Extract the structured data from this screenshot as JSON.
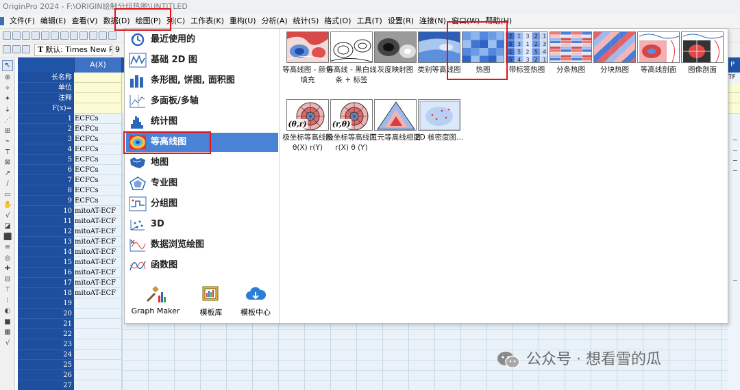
{
  "window": {
    "title": "OriginPro 2024 - F:\\ORIGIN绘制分组热图\\UNTITLED"
  },
  "menubar": [
    "文件(F)",
    "编辑(E)",
    "查看(V)",
    "数据(D)",
    "绘图(P)",
    "列(C)",
    "工作表(K)",
    "重构(U)",
    "分析(A)",
    "统计(S)",
    "格式(O)",
    "工具(T)",
    "设置(R)",
    "连接(N)",
    "窗口(W)",
    "帮助(H)"
  ],
  "toolbar": {
    "font_name": "默认: Times New R",
    "font_size": "9"
  },
  "sheet": {
    "column_a_header": "A(X)",
    "row_labels": [
      "长名称",
      "单位",
      "注释",
      "F(x)="
    ],
    "row_numbers": [
      "1",
      "2",
      "3",
      "4",
      "5",
      "6",
      "7",
      "8",
      "9",
      "10",
      "11",
      "12",
      "13",
      "14",
      "15",
      "16",
      "17",
      "18",
      "19",
      "20",
      "21",
      "22",
      "23",
      "24",
      "25",
      "26",
      "27"
    ],
    "column_a_values": [
      "ECFCs",
      "ECFCs",
      "ECFCs",
      "ECFCs",
      "ECFCs",
      "ECFCs",
      "ECFCs",
      "ECFCs",
      "ECFCs",
      "mitoAT-ECF",
      "mitoAT-ECF",
      "mitoAT-ECF",
      "mitoAT-ECF",
      "mitoAT-ECF",
      "mitoAT-ECF",
      "mitoAT-ECF",
      "mitoAT-ECF",
      "mitoAT-ECF"
    ],
    "right_column_header": "P",
    "right_column_top_cell": "TF"
  },
  "plot_menu": {
    "categories": [
      {
        "label": "最近使用的",
        "icon": "recent-clock-icon",
        "selected": false
      },
      {
        "label": "基础 2D 图",
        "icon": "basic-2d-line-icon",
        "selected": false
      },
      {
        "label": "条形图, 饼图, 面积图",
        "icon": "bar-chart-icon",
        "selected": false
      },
      {
        "label": "多面板/多轴",
        "icon": "multi-panel-icon",
        "selected": false
      },
      {
        "label": "统计图",
        "icon": "histogram-icon",
        "selected": false
      },
      {
        "label": "等高线图",
        "icon": "contour-icon",
        "selected": true
      },
      {
        "label": "地图",
        "icon": "map-icon",
        "selected": false
      },
      {
        "label": "专业图",
        "icon": "specialized-polar-icon",
        "selected": false
      },
      {
        "label": "分组图",
        "icon": "grouped-plot-icon",
        "selected": false
      },
      {
        "label": "3D",
        "icon": "3d-scatter-icon",
        "selected": false
      },
      {
        "label": "数据浏览绘图",
        "icon": "data-explore-icon",
        "selected": false
      },
      {
        "label": "函数图",
        "icon": "function-plot-icon",
        "selected": false
      }
    ],
    "bottom_buttons": [
      {
        "label": "Graph Maker",
        "icon": "graph-maker-icon"
      },
      {
        "label": "模板库",
        "icon": "template-library-icon"
      },
      {
        "label": "模板中心",
        "icon": "template-center-cloud-icon"
      }
    ],
    "gallery": [
      {
        "label": "等高线图 - 颜色填充",
        "icon": "contour-color-fill-thumb"
      },
      {
        "label": "等高线 - 黑白线条 + 标签",
        "icon": "contour-bw-lines-thumb"
      },
      {
        "label": "灰度映射图",
        "icon": "gray-scale-map-thumb"
      },
      {
        "label": "类别等高线图",
        "icon": "category-contour-thumb"
      },
      {
        "label": "热图",
        "icon": "heatmap-thumb"
      },
      {
        "label": "带标签热图",
        "icon": "labeled-heatmap-thumb"
      },
      {
        "label": "分条热图",
        "icon": "split-stripe-heatmap-thumb"
      },
      {
        "label": "分块热图",
        "icon": "split-block-heatmap-thumb"
      },
      {
        "label": "等高线剖面",
        "icon": "contour-profile-thumb"
      },
      {
        "label": "图像剖面",
        "icon": "image-profile-thumb"
      },
      {
        "label": "极坐标等高线图θ(X) r(Y)",
        "icon": "polar-contour-theta-r-thumb",
        "glyph": "(θ,r)"
      },
      {
        "label": "极坐标等高线图 r(X) θ (Y)",
        "icon": "polar-contour-r-theta-thumb",
        "glyph": "(r,θ)"
      },
      {
        "label": "三元等高线相图",
        "icon": "ternary-contour-thumb"
      },
      {
        "label": "2D 核密度图...",
        "icon": "2d-kernel-density-thumb"
      }
    ],
    "labeled_heatmap_numbers": [
      "2",
      "1",
      "3",
      "2",
      "1",
      "5",
      "3",
      "1",
      "2",
      "3",
      "1",
      "5",
      "2",
      "5",
      "4",
      "5",
      "4",
      "3",
      "2",
      "1"
    ]
  },
  "watermark": {
    "text": "公众号 · 想看雪的瓜",
    "icon": "wechat-icon"
  },
  "colors": {
    "accent_selected": "#4a83d5",
    "highlight_red": "#e0121b",
    "sheet_header_blue": "#1f54a6",
    "cell_blue": "#eaf3fa",
    "meta_yellow": "#fbfbd6"
  }
}
